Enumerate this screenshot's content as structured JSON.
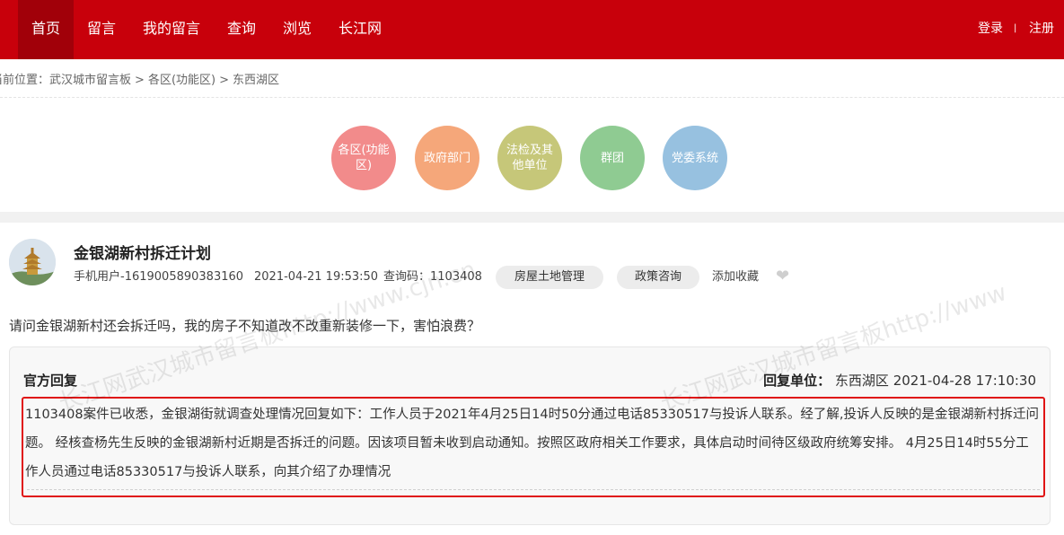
{
  "nav": {
    "items": [
      "首页",
      "留言",
      "我的留言",
      "查询",
      "浏览",
      "长江网"
    ],
    "login": "登录",
    "sep": "|",
    "register": "注册"
  },
  "breadcrumb": {
    "prefix": "当前位置：",
    "items": [
      "武汉城市留言板",
      "各区(功能区)",
      "东西湖区"
    ],
    "sep": ">"
  },
  "categories": [
    {
      "label": "各区(功能区)",
      "color": "#f28b8b"
    },
    {
      "label": "政府部门",
      "color": "#f5a77a"
    },
    {
      "label": "法检及其他单位",
      "color": "#c6c779"
    },
    {
      "label": "群团",
      "color": "#8fcb92"
    },
    {
      "label": "党委系统",
      "color": "#97c1e0"
    }
  ],
  "post": {
    "title": "金银湖新村拆迁计划",
    "user": "手机用户-1619005890383160",
    "datetime": "2021-04-21 19:53:50",
    "query_label": "查询码：",
    "query_code": "1103408",
    "tags": [
      "房屋土地管理",
      "政策咨询"
    ],
    "favorite": "添加收藏",
    "question": "请问金银湖新村还会拆迁吗，我的房子不知道改不改重新装修一下，害怕浪费？"
  },
  "reply": {
    "label": "官方回复",
    "unit_label": "回复单位：",
    "unit": "东西湖区",
    "datetime": "2021-04-28 17:10:30",
    "content": "1103408案件已收悉，金银湖街就调查处理情况回复如下：工作人员于2021年4月25日14时50分通过电话85330517与投诉人联系。经了解,投诉人反映的是金银湖新村拆迁问题。 经核查杨先生反映的金银湖新村近期是否拆迁的问题。因该项目暂未收到启动通知。按照区政府相关工作要求，具体启动时间待区级政府统筹安排。 4月25日14时55分工作人员通过电话85330517与投诉人联系，向其介绍了办理情况"
  },
  "watermark": [
    "长江网武汉城市留言板http://www.cjn.cn",
    "长江网武汉城市留言板http://www"
  ]
}
